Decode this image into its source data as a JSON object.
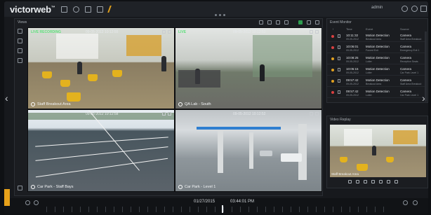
{
  "app": {
    "logo": "victorweb",
    "tm": "™",
    "user": "admin"
  },
  "views": {
    "title": "Views",
    "tiles": [
      {
        "live": "LIVE RECORDING",
        "time": "09-05-2012 10:12:55",
        "label": "Staff Breakout Area"
      },
      {
        "live": "LIVE",
        "time": "09-05-2012 10:12:52",
        "label": "QA Lab - South"
      },
      {
        "live": "",
        "time": "09-05-2012 10:12:58",
        "label": "Car Park - Staff Bays"
      },
      {
        "live": "",
        "time": "09-05-2012 10:12:52",
        "label": "Car Park - Level 1"
      }
    ]
  },
  "events": {
    "title": "Event Monitor",
    "columns": [
      "!",
      "Time",
      "Event",
      "Source"
    ],
    "rows": [
      {
        "color": "#d94040",
        "time": "10:11:32",
        "date": "09-05-2012",
        "event": "Motion Detection",
        "detail": "Breakout Area",
        "source": "Camera",
        "src2": "Staff Area Breakout"
      },
      {
        "color": "#d94040",
        "time": "10:06:01",
        "date": "09-05-2012",
        "event": "Motion Detection",
        "detail": "Forced Exit",
        "source": "Camera",
        "src2": "Emergency Exit 1"
      },
      {
        "color": "#e0a020",
        "time": "10:08:25",
        "date": "09-05-2012",
        "event": "Motion Detection",
        "detail": "Loiter",
        "source": "Camera",
        "src2": "Reception Seats"
      },
      {
        "color": "#e0a020",
        "time": "10:05:15",
        "date": "09-05-2012",
        "event": "Motion Detection",
        "detail": "Loiter",
        "source": "Camera",
        "src2": "Car Park Level 1"
      },
      {
        "color": "#e0a020",
        "time": "09:57:42",
        "date": "09-05-2012",
        "event": "Motion Detection",
        "detail": "Breakout Area",
        "source": "Camera",
        "src2": "Staff Area Breakout"
      },
      {
        "color": "#d94040",
        "time": "09:57:42",
        "date": "09-05-2012",
        "event": "Motion Detection",
        "detail": "Loiter",
        "source": "Camera",
        "src2": "Car Park Level 1"
      }
    ]
  },
  "replay": {
    "title": "Video Replay",
    "label": "Staff Breakout Area"
  },
  "timeline": {
    "date": "01/27/2015",
    "time": "03:44:01 PM"
  }
}
